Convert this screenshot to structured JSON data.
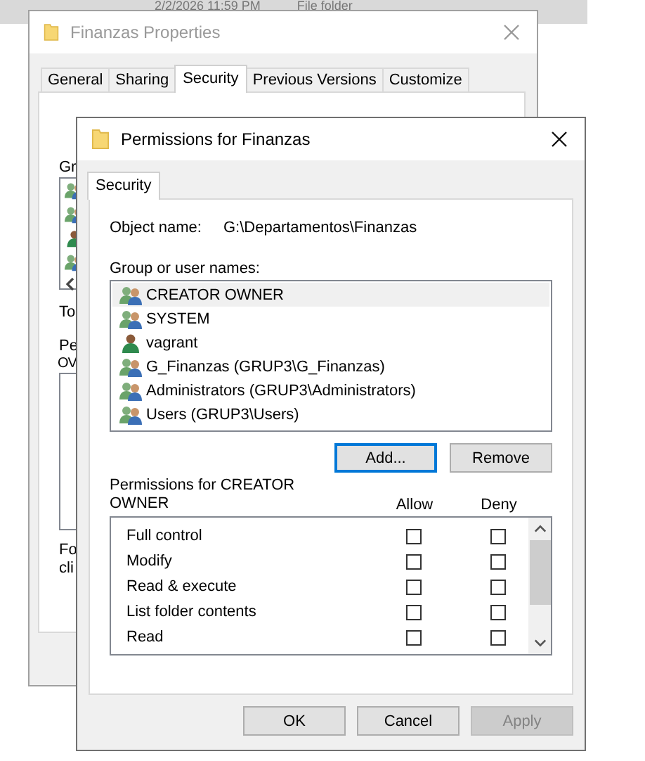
{
  "background_bar": {
    "date": "2/2/2026 11:59 PM",
    "type": "File folder"
  },
  "back_window": {
    "title": "Finanzas Properties",
    "tabs": [
      {
        "label": "General",
        "selected": false
      },
      {
        "label": "Sharing",
        "selected": false
      },
      {
        "label": "Security",
        "selected": true
      },
      {
        "label": "Previous Versions",
        "selected": false
      },
      {
        "label": "Customize",
        "selected": false
      }
    ],
    "group_label": "Gr",
    "list_icons": [
      {
        "kind": "group"
      },
      {
        "kind": "group"
      },
      {
        "kind": "user"
      },
      {
        "kind": "group"
      }
    ],
    "to_label": "To",
    "perm_label_1": "Pe",
    "perm_label_2": "OV",
    "footer_1": "Fo",
    "footer_2": "cli"
  },
  "front_window": {
    "title": "Permissions for Finanzas",
    "tabs": [
      {
        "label": "Security",
        "selected": true
      }
    ],
    "object_label": "Object name:",
    "object_value": "G:\\Departamentos\\Finanzas",
    "group_label": "Group or user names:",
    "principals": [
      {
        "name": "CREATOR OWNER",
        "kind": "group",
        "selected": true
      },
      {
        "name": "SYSTEM",
        "kind": "group",
        "selected": false
      },
      {
        "name": "vagrant",
        "kind": "user",
        "selected": false
      },
      {
        "name": "G_Finanzas (GRUP3\\G_Finanzas)",
        "kind": "group",
        "selected": false
      },
      {
        "name": "Administrators (GRUP3\\Administrators)",
        "kind": "group",
        "selected": false
      },
      {
        "name": "Users (GRUP3\\Users)",
        "kind": "group",
        "selected": false
      }
    ],
    "list_buttons": [
      {
        "label": "Add...",
        "focused": true
      },
      {
        "label": "Remove",
        "focused": false
      }
    ],
    "permissions_label": "Permissions for CREATOR OWNER",
    "allow_header": "Allow",
    "deny_header": "Deny",
    "permissions": [
      {
        "name": "Full control",
        "allow": false,
        "deny": false
      },
      {
        "name": "Modify",
        "allow": false,
        "deny": false
      },
      {
        "name": "Read & execute",
        "allow": false,
        "deny": false
      },
      {
        "name": "List folder contents",
        "allow": false,
        "deny": false
      },
      {
        "name": "Read",
        "allow": false,
        "deny": false
      }
    ],
    "buttons": [
      {
        "label": "OK",
        "disabled": false
      },
      {
        "label": "Cancel",
        "disabled": false
      },
      {
        "label": "Apply",
        "disabled": true
      }
    ]
  }
}
